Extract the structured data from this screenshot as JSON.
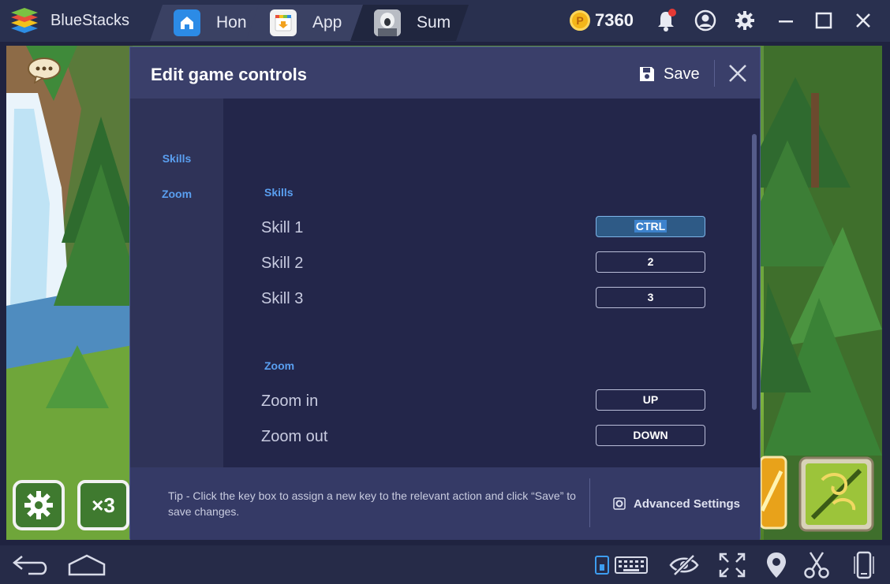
{
  "titlebar": {
    "app_name": "BlueStacks",
    "tabs": [
      {
        "label": "Hon",
        "icon": "home-icon"
      },
      {
        "label": "App",
        "icon": "app-center-icon"
      },
      {
        "label": "Sum",
        "icon": "game-icon"
      }
    ],
    "coin_symbol": "P",
    "coins": "7360",
    "icons": [
      "bell-icon",
      "account-icon",
      "gear-icon",
      "minimize-icon",
      "maximize-icon",
      "close-icon"
    ]
  },
  "dialog": {
    "title": "Edit game controls",
    "save_label": "Save",
    "nav": [
      {
        "label": "Skills"
      },
      {
        "label": "Zoom"
      }
    ],
    "sections": [
      {
        "title": "Skills",
        "rows": [
          {
            "label": "Skill 1",
            "key": "CTRL"
          },
          {
            "label": "Skill 2",
            "key": "2"
          },
          {
            "label": "Skill 3",
            "key": "3"
          }
        ]
      },
      {
        "title": "Zoom",
        "rows": [
          {
            "label": "Zoom in",
            "key": "UP"
          },
          {
            "label": "Zoom out",
            "key": "DOWN"
          }
        ]
      }
    ],
    "tip": "Tip - Click the key box to assign a new key to the relevant action and click “Save” to save changes.",
    "advanced_label": "Advanced Settings"
  },
  "game_overlay": {
    "multiplier": "×3"
  },
  "colors": {
    "accent_blue": "#5a9ff0",
    "coin_gold": "#f4b619",
    "notification_red": "#e53935"
  }
}
